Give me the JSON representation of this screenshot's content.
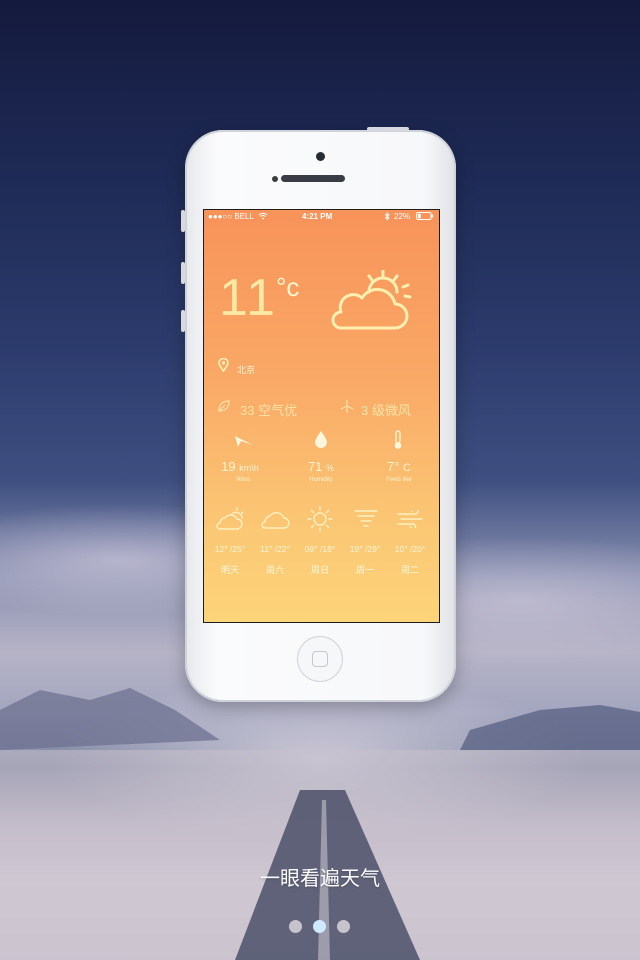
{
  "status_bar": {
    "carrier": "●●●○○ BELL",
    "time": "4:21 PM",
    "battery": "22%"
  },
  "weather": {
    "temperature": "11",
    "unit": "°c",
    "city": "北京",
    "air_quality": "33 空气优",
    "wind_level": "3 级微风"
  },
  "stats": [
    {
      "value": "19",
      "unit": "km\\h",
      "label": "Wind",
      "icon": "paper-plane-icon"
    },
    {
      "value": "71",
      "unit": "%",
      "label": "Humidity",
      "icon": "water-drop-icon"
    },
    {
      "value": "7°",
      "unit": "C",
      "label": "Feels like",
      "icon": "thermometer-icon"
    }
  ],
  "forecast": [
    {
      "temp": "12° /25°",
      "day": "明天",
      "icon": "partly-cloudy-icon"
    },
    {
      "temp": "11° /22°",
      "day": "周六",
      "icon": "cloud-icon"
    },
    {
      "temp": "09° /18°",
      "day": "周日",
      "icon": "sun-icon"
    },
    {
      "temp": "18° /29°",
      "day": "周一",
      "icon": "tornado-icon"
    },
    {
      "temp": "10° /20°",
      "day": "周二",
      "icon": "windy-icon"
    }
  ],
  "caption": "一眼看遍天气",
  "pagination": {
    "total": 3,
    "active": 2
  },
  "colors": {
    "screen_top": "#f8935a",
    "screen_bottom": "#fcd479",
    "text_light": "#fff3cf",
    "dot_active": "#cfeafe",
    "dot_inactive": "#c6c3cc"
  }
}
